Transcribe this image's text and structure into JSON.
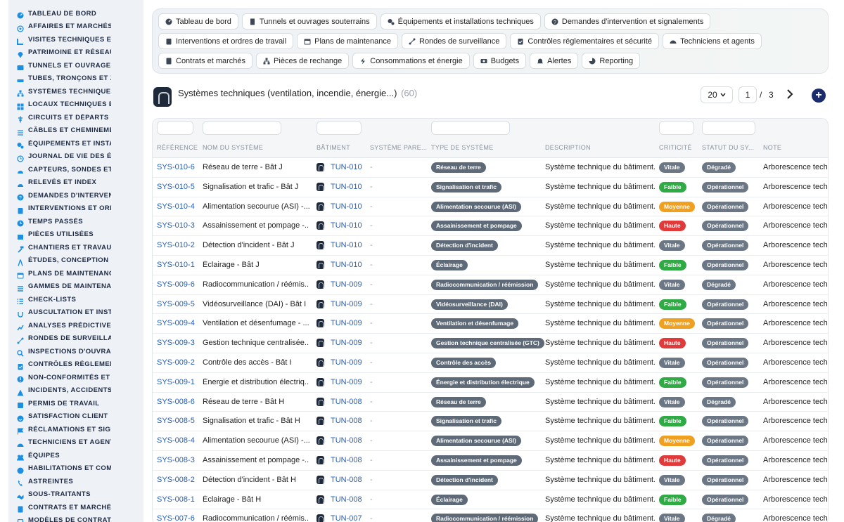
{
  "sidebar": {
    "items": [
      {
        "label": "Tableau de bord",
        "icon": "dashboard-icon"
      },
      {
        "label": "Affaires et marchés",
        "icon": "target-icon"
      },
      {
        "label": "Visites techniques et",
        "icon": "ruler-icon"
      },
      {
        "label": "Patrimoine et réseaux",
        "icon": "pin-icon"
      },
      {
        "label": "Tunnels et ouvrages",
        "icon": "tunnel-icon"
      },
      {
        "label": "Tubes, tronçons et zo",
        "icon": "pipe-icon"
      },
      {
        "label": "Systèmes techniques",
        "icon": "hierarchy-icon"
      },
      {
        "label": "Locaux techniques et",
        "icon": "grid-icon"
      },
      {
        "label": "Circuits et départs él",
        "icon": "circuit-icon"
      },
      {
        "label": "Câbles et cheminemen",
        "icon": "cable-icon"
      },
      {
        "label": "Équipements et instal",
        "icon": "cogs-icon"
      },
      {
        "label": "Journal de vie des éq",
        "icon": "history-icon"
      },
      {
        "label": "Capteurs, sondes et c",
        "icon": "gauge-icon"
      },
      {
        "label": "Relevés et index",
        "icon": "gauge-icon"
      },
      {
        "label": "Demandes d'intervent",
        "icon": "question-icon"
      },
      {
        "label": "Interventions et ordr",
        "icon": "clipboard-icon"
      },
      {
        "label": "Temps passés",
        "icon": "clock-icon"
      },
      {
        "label": "Pièces utilisées",
        "icon": "box-icon"
      },
      {
        "label": "Chantiers et travaux",
        "icon": "hammer-icon"
      },
      {
        "label": "Études, conception et",
        "icon": "compass-icon"
      },
      {
        "label": "Plans de maintenance",
        "icon": "calendar-icon"
      },
      {
        "label": "Gammes de maintenan",
        "icon": "list-icon"
      },
      {
        "label": "Check-lists",
        "icon": "checklist-icon"
      },
      {
        "label": "Auscultation et instr",
        "icon": "stethoscope-icon"
      },
      {
        "label": "Analyses prédictives",
        "icon": "chart-icon"
      },
      {
        "label": "Rondes de surveillan",
        "icon": "route-icon"
      },
      {
        "label": "Inspections d'ouvrag",
        "icon": "search-icon"
      },
      {
        "label": "Contrôles réglement",
        "icon": "clipboard-check-icon"
      },
      {
        "label": "Non-conformités et a",
        "icon": "warning-icon"
      },
      {
        "label": "Incidents, accidents e",
        "icon": "alert-icon"
      },
      {
        "label": "Permis de travail",
        "icon": "permit-icon"
      },
      {
        "label": "Satisfaction client",
        "icon": "smile-icon"
      },
      {
        "label": "Réclamations et signa",
        "icon": "flag-icon"
      },
      {
        "label": "Techniciens et agents",
        "icon": "helmet-icon"
      },
      {
        "label": "Équipes",
        "icon": "users-icon"
      },
      {
        "label": "Habilitations et comp",
        "icon": "badge-icon"
      },
      {
        "label": "Astreintes",
        "icon": "phone-icon"
      },
      {
        "label": "Sous-traitants",
        "icon": "handshake-icon"
      },
      {
        "label": "Contrats et marchés",
        "icon": "contract-icon"
      },
      {
        "label": "Modèles de contrats",
        "icon": "template-icon"
      }
    ]
  },
  "nav": {
    "chips": [
      {
        "label": "Tableau de bord",
        "icon": "dashboard-icon"
      },
      {
        "label": "Tunnels et ouvrages souterrains",
        "icon": "building-icon"
      },
      {
        "label": "Équipements et installations techniques",
        "icon": "cogs-icon"
      },
      {
        "label": "Demandes d'intervention et signalements",
        "icon": "question-icon"
      },
      {
        "label": "Interventions et ordres de travail",
        "icon": "clipboard-icon"
      },
      {
        "label": "Plans de maintenance",
        "icon": "calendar-icon"
      },
      {
        "label": "Rondes de surveillance",
        "icon": "route-icon"
      },
      {
        "label": "Contrôles réglementaires et sécurité",
        "icon": "clipboard-check-icon"
      },
      {
        "label": "Techniciens et agents",
        "icon": "helmet-icon"
      },
      {
        "label": "Contrats et marchés",
        "icon": "contract-icon"
      },
      {
        "label": "Pièces de rechange",
        "icon": "hierarchy-icon"
      },
      {
        "label": "Consommations et énergie",
        "icon": "bolt-icon"
      },
      {
        "label": "Budgets",
        "icon": "money-icon"
      },
      {
        "label": "Alertes",
        "icon": "bell-icon"
      },
      {
        "label": "Reporting",
        "icon": "pie-icon"
      }
    ]
  },
  "header": {
    "title": "Systèmes techniques (ventilation, incendie, énergie...)",
    "count": "(60)",
    "page_size": "20",
    "current_page": "1",
    "page_sep": "/",
    "total_pages": "3",
    "add_label": "+"
  },
  "table": {
    "columns": [
      "Référence",
      "Nom du système",
      "Bâtiment",
      "Système pare...",
      "Type de système",
      "Description",
      "Criticité",
      "Statut du sy...",
      "Note"
    ],
    "rows": [
      {
        "ref": "SYS-010-6",
        "name": "Réseau de terre - Bât J",
        "bat": "TUN-010",
        "parent": "-",
        "type": "Réseau de terre",
        "desc": "Système technique du bâtiment.",
        "crit": "Vitale",
        "stat": "Dégradé",
        "note": "Arborescence techn"
      },
      {
        "ref": "SYS-010-5",
        "name": "Signalisation et trafic - Bât J",
        "bat": "TUN-010",
        "parent": "-",
        "type": "Signalisation et trafic",
        "desc": "Système technique du bâtiment.",
        "crit": "Faible",
        "stat": "Opérationnel",
        "note": "Arborescence techn"
      },
      {
        "ref": "SYS-010-4",
        "name": "Alimentation secourue (ASI) -...",
        "bat": "TUN-010",
        "parent": "-",
        "type": "Alimentation secourue (ASI)",
        "desc": "Système technique du bâtiment.",
        "crit": "Moyenne",
        "stat": "Opérationnel",
        "note": "Arborescence techn"
      },
      {
        "ref": "SYS-010-3",
        "name": "Assainissement et pompage -...",
        "bat": "TUN-010",
        "parent": "-",
        "type": "Assainissement et pompage",
        "desc": "Système technique du bâtiment.",
        "crit": "Haute",
        "stat": "Opérationnel",
        "note": "Arborescence techn"
      },
      {
        "ref": "SYS-010-2",
        "name": "Détection d'incident - Bât J",
        "bat": "TUN-010",
        "parent": "-",
        "type": "Détection d'incident",
        "desc": "Système technique du bâtiment.",
        "crit": "Vitale",
        "stat": "Opérationnel",
        "note": "Arborescence techn"
      },
      {
        "ref": "SYS-010-1",
        "name": "Éclairage - Bât J",
        "bat": "TUN-010",
        "parent": "-",
        "type": "Éclairage",
        "desc": "Système technique du bâtiment.",
        "crit": "Faible",
        "stat": "Opérationnel",
        "note": "Arborescence techn"
      },
      {
        "ref": "SYS-009-6",
        "name": "Radiocommunication / réémis...",
        "bat": "TUN-009",
        "parent": "-",
        "type": "Radiocommunication / réémission",
        "desc": "Système technique du bâtiment.",
        "crit": "Vitale",
        "stat": "Dégradé",
        "note": "Arborescence techn"
      },
      {
        "ref": "SYS-009-5",
        "name": "Vidéosurveillance (DAI) - Bât I",
        "bat": "TUN-009",
        "parent": "-",
        "type": "Vidéosurveillance (DAI)",
        "desc": "Système technique du bâtiment.",
        "crit": "Faible",
        "stat": "Opérationnel",
        "note": "Arborescence techn"
      },
      {
        "ref": "SYS-009-4",
        "name": "Ventilation et désenfumage - ...",
        "bat": "TUN-009",
        "parent": "-",
        "type": "Ventilation et désenfumage",
        "desc": "Système technique du bâtiment.",
        "crit": "Moyenne",
        "stat": "Opérationnel",
        "note": "Arborescence techn"
      },
      {
        "ref": "SYS-009-3",
        "name": "Gestion technique centralisée...",
        "bat": "TUN-009",
        "parent": "-",
        "type": "Gestion technique centralisée (GTC)",
        "desc": "Système technique du bâtiment.",
        "crit": "Haute",
        "stat": "Opérationnel",
        "note": "Arborescence techn"
      },
      {
        "ref": "SYS-009-2",
        "name": "Contrôle des accès - Bât I",
        "bat": "TUN-009",
        "parent": "-",
        "type": "Contrôle des accès",
        "desc": "Système technique du bâtiment.",
        "crit": "Vitale",
        "stat": "Opérationnel",
        "note": "Arborescence techn"
      },
      {
        "ref": "SYS-009-1",
        "name": "Énergie et distribution électriq...",
        "bat": "TUN-009",
        "parent": "-",
        "type": "Énergie et distribution électrique",
        "desc": "Système technique du bâtiment.",
        "crit": "Faible",
        "stat": "Opérationnel",
        "note": "Arborescence techn"
      },
      {
        "ref": "SYS-008-6",
        "name": "Réseau de terre - Bât H",
        "bat": "TUN-008",
        "parent": "-",
        "type": "Réseau de terre",
        "desc": "Système technique du bâtiment.",
        "crit": "Vitale",
        "stat": "Dégradé",
        "note": "Arborescence techn"
      },
      {
        "ref": "SYS-008-5",
        "name": "Signalisation et trafic - Bât H",
        "bat": "TUN-008",
        "parent": "-",
        "type": "Signalisation et trafic",
        "desc": "Système technique du bâtiment.",
        "crit": "Faible",
        "stat": "Opérationnel",
        "note": "Arborescence techn"
      },
      {
        "ref": "SYS-008-4",
        "name": "Alimentation secourue (ASI) -...",
        "bat": "TUN-008",
        "parent": "-",
        "type": "Alimentation secourue (ASI)",
        "desc": "Système technique du bâtiment.",
        "crit": "Moyenne",
        "stat": "Opérationnel",
        "note": "Arborescence techn"
      },
      {
        "ref": "SYS-008-3",
        "name": "Assainissement et pompage -...",
        "bat": "TUN-008",
        "parent": "-",
        "type": "Assainissement et pompage",
        "desc": "Système technique du bâtiment.",
        "crit": "Haute",
        "stat": "Opérationnel",
        "note": "Arborescence techn"
      },
      {
        "ref": "SYS-008-2",
        "name": "Détection d'incident - Bât H",
        "bat": "TUN-008",
        "parent": "-",
        "type": "Détection d'incident",
        "desc": "Système technique du bâtiment.",
        "crit": "Vitale",
        "stat": "Opérationnel",
        "note": "Arborescence techn"
      },
      {
        "ref": "SYS-008-1",
        "name": "Éclairage - Bât H",
        "bat": "TUN-008",
        "parent": "-",
        "type": "Éclairage",
        "desc": "Système technique du bâtiment.",
        "crit": "Faible",
        "stat": "Opérationnel",
        "note": "Arborescence techn"
      },
      {
        "ref": "SYS-007-6",
        "name": "Radiocommunication / réémis...",
        "bat": "TUN-007",
        "parent": "-",
        "type": "Radiocommunication / réémission",
        "desc": "Système technique du bâtiment.",
        "crit": "Vitale",
        "stat": "Dégradé",
        "note": "Arborescence techn"
      }
    ]
  },
  "colors": {
    "link": "#1f5fbf",
    "sidebar_icon": "#1d8fe0",
    "type_pill": "#5e6a78",
    "crit_vitale": "#6b7785",
    "crit_faible": "#2faa44",
    "crit_moyenne": "#f0a020",
    "crit_haute": "#e03a3a",
    "stat_degrade": "#6b7785",
    "stat_operationnel": "#6b7785",
    "add_button": "#1a2c6b"
  }
}
